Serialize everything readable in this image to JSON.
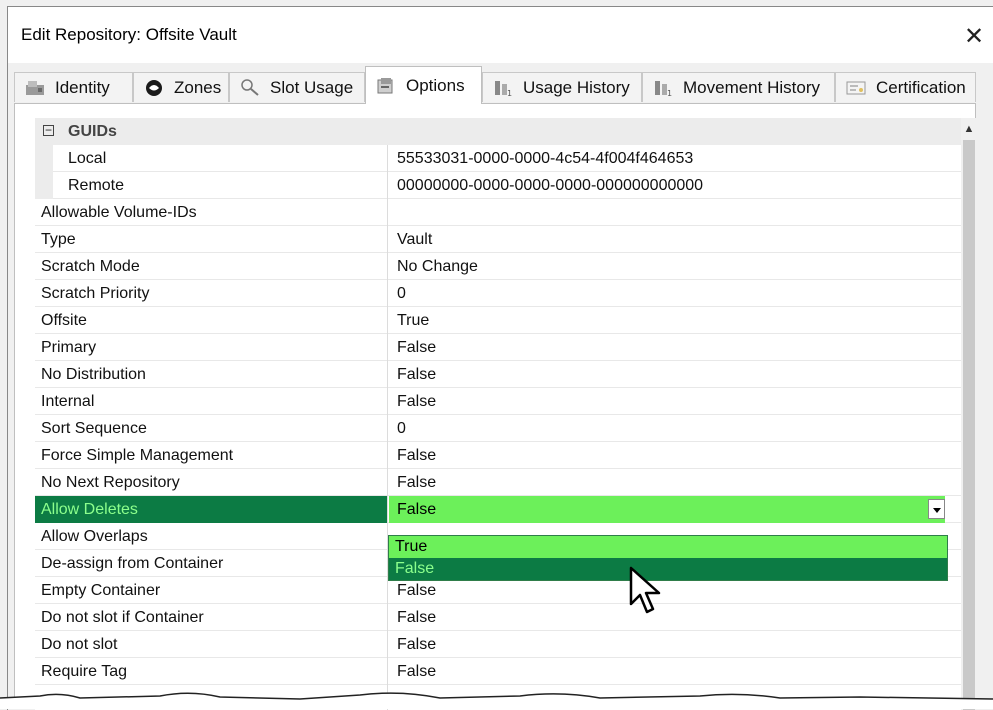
{
  "window": {
    "title": "Edit Repository: Offsite Vault",
    "close_glyph": "✕"
  },
  "tabs": [
    {
      "label": "Identity",
      "icon": "identity-icon"
    },
    {
      "label": "Zones",
      "icon": "zones-icon"
    },
    {
      "label": "Slot Usage",
      "icon": "magnifier-icon"
    },
    {
      "label": "Options",
      "icon": "options-icon",
      "active": true
    },
    {
      "label": "Usage History",
      "icon": "usage-history-icon"
    },
    {
      "label": "Movement History",
      "icon": "movement-history-icon"
    },
    {
      "label": "Certification",
      "icon": "certification-icon"
    }
  ],
  "grid": {
    "category": {
      "label": "GUIDs",
      "toggle": "⊟"
    },
    "guid_rows": [
      {
        "name": "Local",
        "value": "55533031-0000-0000-4c54-4f004f464653"
      },
      {
        "name": "Remote",
        "value": "00000000-0000-0000-0000-000000000000"
      }
    ],
    "rows": [
      {
        "name": "Allowable Volume-IDs",
        "value": ""
      },
      {
        "name": "Type",
        "value": "Vault"
      },
      {
        "name": "Scratch Mode",
        "value": "No Change"
      },
      {
        "name": "Scratch Priority",
        "value": "0"
      },
      {
        "name": "Offsite",
        "value": "True"
      },
      {
        "name": "Primary",
        "value": "False"
      },
      {
        "name": "No Distribution",
        "value": "False"
      },
      {
        "name": "Internal",
        "value": "False"
      },
      {
        "name": "Sort Sequence",
        "value": "0"
      },
      {
        "name": "Force Simple Management",
        "value": "False"
      },
      {
        "name": "No Next Repository",
        "value": "False"
      },
      {
        "name": "Allow Deletes",
        "value": "False",
        "selected": true
      },
      {
        "name": "Allow Overlaps",
        "value": ""
      },
      {
        "name": "De-assign from Container",
        "value": ""
      },
      {
        "name": "Empty Container",
        "value": "False"
      },
      {
        "name": "Do not slot if Container",
        "value": "False"
      },
      {
        "name": "Do not slot",
        "value": "False"
      },
      {
        "name": "Require Tag",
        "value": "False"
      }
    ],
    "dropdown_options": [
      "True",
      "False"
    ],
    "dropdown_highlighted": "False"
  },
  "colors": {
    "selected_name_bg": "#0c7b44",
    "selected_value_bg": "#6cf05a",
    "selected_text": "#8cff8c"
  }
}
